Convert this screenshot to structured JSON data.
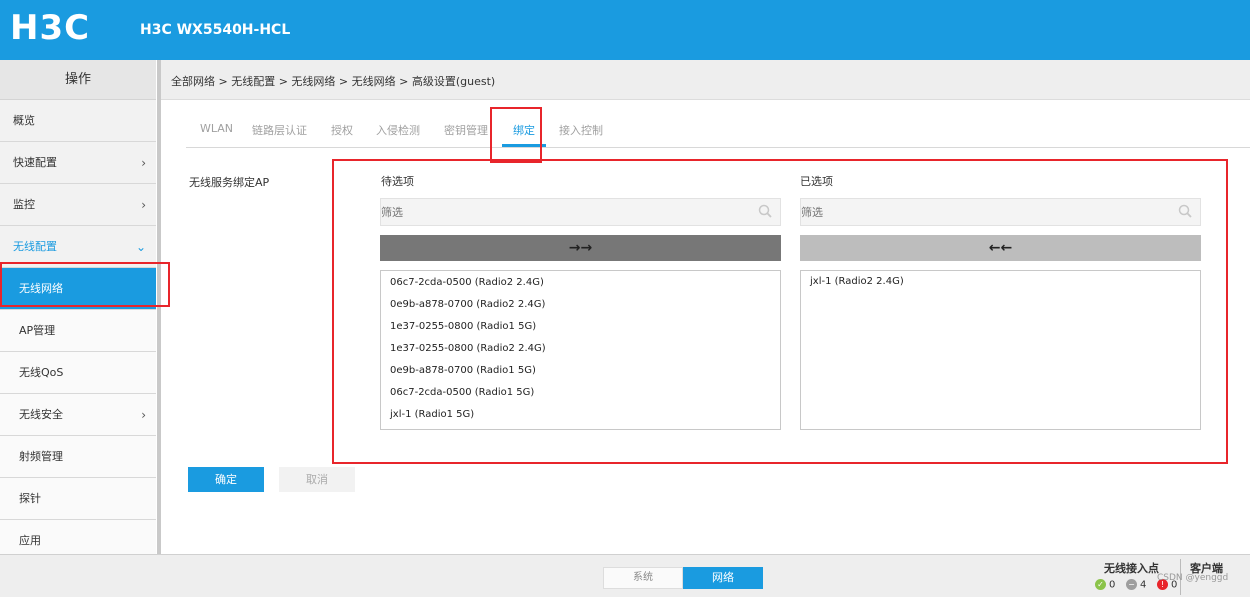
{
  "header": {
    "logo": "H3C",
    "title": "H3C WX5540H-HCL",
    "brand_color": "#1a9be0"
  },
  "sidebar": {
    "heading": "操作",
    "items": [
      {
        "label": "概览"
      },
      {
        "label": "快速配置",
        "arrow": "›"
      },
      {
        "label": "监控",
        "arrow": "›"
      },
      {
        "label": "无线配置",
        "arrow": "⌄"
      },
      {
        "label": "无线网络"
      },
      {
        "label": "AP管理"
      },
      {
        "label": "无线QoS"
      },
      {
        "label": "无线安全",
        "arrow": "›"
      },
      {
        "label": "射频管理"
      },
      {
        "label": "探针"
      },
      {
        "label": "应用"
      }
    ]
  },
  "breadcrumb": "全部网络 > 无线配置 > 无线网络 > 无线网络 > 高级设置(guest)",
  "tabs": [
    "WLAN",
    "链路层认证",
    "授权",
    "入侵检测",
    "密钥管理",
    "绑定",
    "接入控制"
  ],
  "active_tab": "绑定",
  "binding": {
    "label": "无线服务绑定AP",
    "available_title": "待选项",
    "selected_title": "已选项",
    "filter_placeholder": "筛选",
    "move_right": "→→",
    "move_left": "←←",
    "available": [
      "06c7-2cda-0500 (Radio2 2.4G)",
      "0e9b-a878-0700 (Radio2 2.4G)",
      "1e37-0255-0800 (Radio1 5G)",
      "1e37-0255-0800 (Radio2 2.4G)",
      "0e9b-a878-0700 (Radio1 5G)",
      "06c7-2cda-0500 (Radio1 5G)",
      "jxl-1 (Radio1 5G)"
    ],
    "selected": [
      "jxl-1 (Radio2 2.4G)"
    ]
  },
  "buttons": {
    "ok": "确定",
    "cancel": "取消"
  },
  "footer": {
    "system": "系统",
    "network": "网络",
    "ap_label": "无线接入点",
    "client_label": "客户端",
    "stat_ok": "0",
    "stat_minus": "4",
    "stat_err": "0",
    "watermark": "CSDN @yenggd"
  }
}
